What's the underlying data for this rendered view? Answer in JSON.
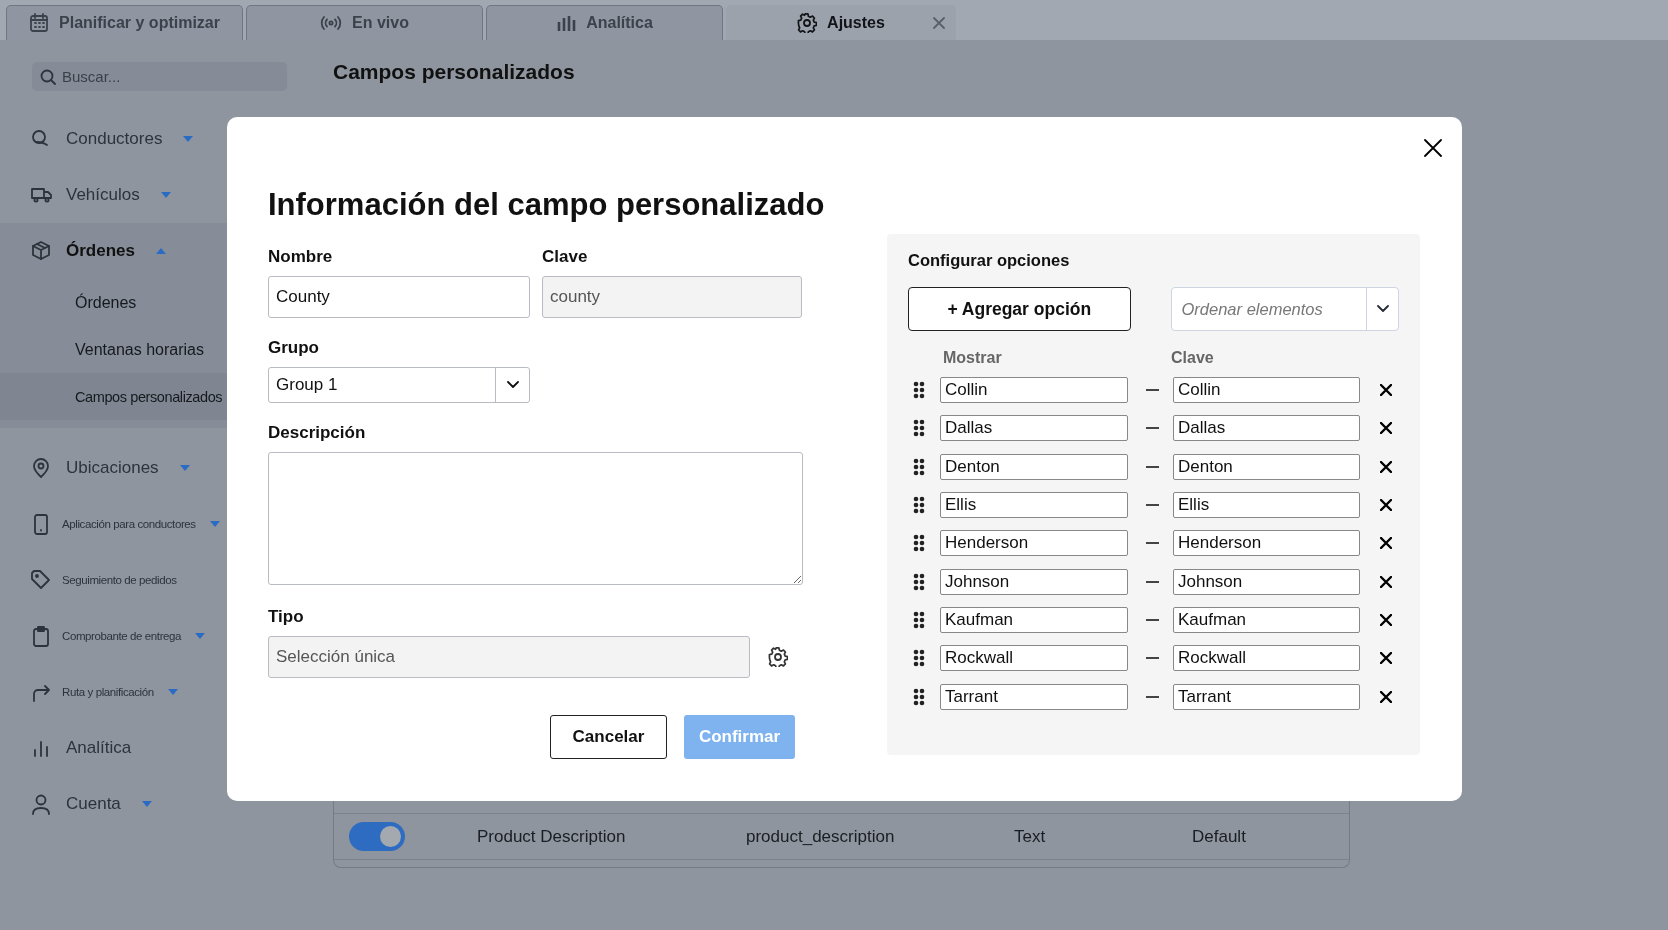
{
  "tabs": [
    {
      "label": "Planificar y optimizar",
      "selected": false,
      "closable": false
    },
    {
      "label": "En vivo",
      "selected": false,
      "closable": false
    },
    {
      "label": "Analítica",
      "selected": false,
      "closable": false
    },
    {
      "label": "Ajustes",
      "selected": true,
      "closable": true
    }
  ],
  "sidebar": {
    "search": {
      "placeholder": "Buscar..."
    },
    "items": [
      {
        "label": "Conductores",
        "expandable": true,
        "expanded": false,
        "compact": false
      },
      {
        "label": "Vehículos",
        "expandable": true,
        "expanded": false,
        "compact": false
      },
      {
        "label": "Órdenes",
        "expandable": true,
        "expanded": true,
        "compact": false,
        "children": [
          {
            "label": "Órdenes",
            "selected": false
          },
          {
            "label": "Ventanas horarias",
            "selected": false
          },
          {
            "label": "Campos personalizados",
            "selected": true
          }
        ]
      },
      {
        "label": "Ubicaciones",
        "expandable": true,
        "expanded": false,
        "compact": false
      },
      {
        "label": "Aplicación para conductores",
        "expandable": true,
        "expanded": false,
        "compact": true
      },
      {
        "label": "Seguimiento de pedidos",
        "expandable": false,
        "expanded": false,
        "compact": true
      },
      {
        "label": "Comprobante de entrega",
        "expandable": true,
        "expanded": false,
        "compact": true
      },
      {
        "label": "Ruta y planificación",
        "expandable": true,
        "expanded": false,
        "compact": true
      },
      {
        "label": "Analítica",
        "expandable": false,
        "expanded": false,
        "compact": false
      },
      {
        "label": "Cuenta",
        "expandable": true,
        "expanded": false,
        "compact": false
      }
    ]
  },
  "page_title": "Campos personalizados",
  "table": {
    "rows": [
      {
        "enabled": true,
        "name": "Product Description",
        "key": "product_description",
        "type": "Text",
        "source": "Default"
      }
    ]
  },
  "dialog": {
    "title": "Información del campo personalizado",
    "name_field": {
      "label": "Nombre",
      "value": "County",
      "disabled": false
    },
    "key_field": {
      "label": "Clave",
      "value": "county",
      "disabled": true
    },
    "group_field": {
      "label": "Grupo",
      "value": "Group 1"
    },
    "description_field": {
      "label": "Descripción"
    },
    "type_field": {
      "label": "Tipo",
      "value": "Selección única",
      "disabled": true
    },
    "cancel_button": "Cancelar",
    "confirm_button": {
      "label": "Confirmar",
      "disabled": true
    },
    "options_panel": {
      "title": "Configurar opciones",
      "add_button": "+ Agregar opción",
      "sort_placeholder": "Ordenar elementos",
      "columns": [
        "Mostrar",
        "Clave"
      ],
      "options": [
        {
          "display": "Collin",
          "key": "Collin"
        },
        {
          "display": "Dallas",
          "key": "Dallas"
        },
        {
          "display": "Denton",
          "key": "Denton"
        },
        {
          "display": "Ellis",
          "key": "Ellis"
        },
        {
          "display": "Henderson",
          "key": "Henderson"
        },
        {
          "display": "Johnson",
          "key": "Johnson"
        },
        {
          "display": "Kaufman",
          "key": "Kaufman"
        },
        {
          "display": "Rockwall",
          "key": "Rockwall"
        },
        {
          "display": "Tarrant",
          "key": "Tarrant"
        }
      ]
    }
  }
}
